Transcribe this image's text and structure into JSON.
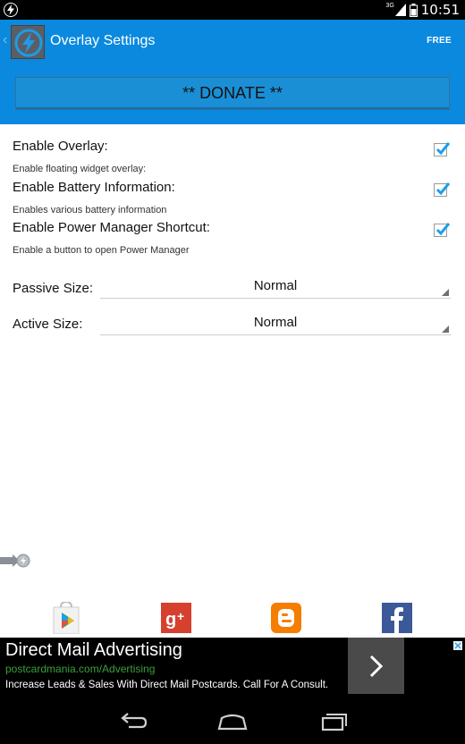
{
  "status_bar": {
    "network_label": "3G",
    "time": "10:51"
  },
  "app_bar": {
    "title": "Overlay Settings",
    "free_label": "FREE"
  },
  "donate": {
    "label": "** DONATE **"
  },
  "preferences": [
    {
      "title": "Enable Overlay:",
      "summary": "Enable floating widget overlay:",
      "checked": true
    },
    {
      "title": "Enable Battery Information:",
      "summary": "Enables various battery information",
      "checked": true
    },
    {
      "title": "Enable Power Manager Shortcut:",
      "summary": "Enable a button to open Power Manager",
      "checked": true
    }
  ],
  "spinners": [
    {
      "label": "Passive Size:",
      "value": "Normal"
    },
    {
      "label": "Active Size:",
      "value": "Normal"
    }
  ],
  "social_icons": [
    "google-play-icon",
    "google-plus-icon",
    "blogger-icon",
    "facebook-icon"
  ],
  "ad": {
    "title": "Direct Mail Advertising",
    "url": "postcardmania.com/Advertising",
    "description": "Increase Leads & Sales With Direct Mail Postcards. Call For A Consult."
  },
  "colors": {
    "accent": "#0a89de",
    "checkbox": "#1aa0e8",
    "ad_url": "#3aa03a"
  },
  "nav_icons": [
    "back-icon",
    "home-icon",
    "recent-apps-icon"
  ]
}
